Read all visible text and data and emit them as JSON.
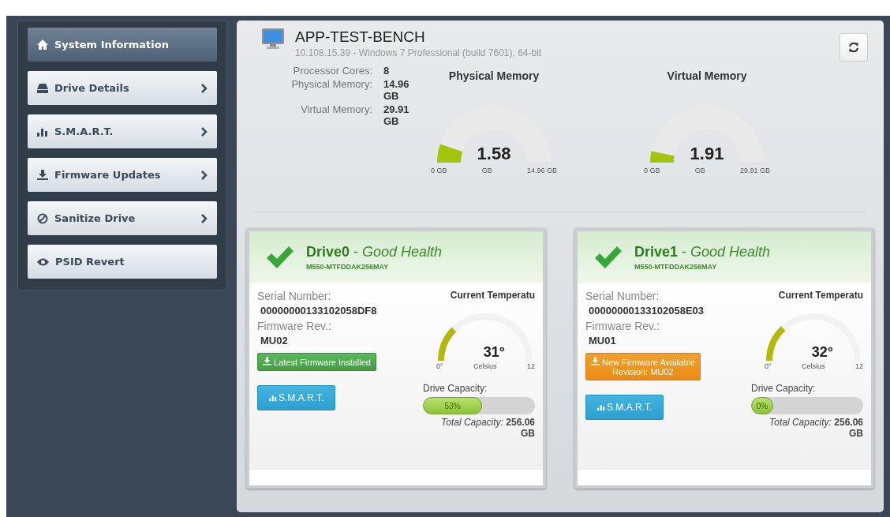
{
  "sidebar": {
    "items": [
      {
        "label": "System Information",
        "selected": true,
        "chevron": false
      },
      {
        "label": "Drive Details",
        "selected": false,
        "chevron": true
      },
      {
        "label": "S.M.A.R.T.",
        "selected": false,
        "chevron": true
      },
      {
        "label": "Firmware Updates",
        "selected": false,
        "chevron": true
      },
      {
        "label": "Sanitize Drive",
        "selected": false,
        "chevron": true
      },
      {
        "label": "PSID Revert",
        "selected": false,
        "chevron": false
      }
    ]
  },
  "system": {
    "hostname": "APP-TEST-BENCH",
    "subtitle": "10.108.15.39 - Windows 7 Professional (build 7601), 64-bit",
    "specs": [
      {
        "label": "Processor Cores:",
        "value": "8"
      },
      {
        "label": "Physical Memory:",
        "value": "14.96 GB"
      },
      {
        "label": "Virtual Memory:",
        "value": "29.91 GB"
      }
    ],
    "gauges": [
      {
        "title": "Physical Memory",
        "value": "1.58",
        "unit": "GB",
        "min": "0 GB",
        "max": "14.96 GB"
      },
      {
        "title": "Virtual Memory",
        "value": "1.91",
        "unit": "GB",
        "min": "0 GB",
        "max": "29.91 GB"
      }
    ]
  },
  "drives": [
    {
      "title": "**Drive0** - *Good Health*",
      "model": "M550-MTFDDAK256MAY",
      "serial_label": "Serial Number:",
      "serial": "00000000133102058DF8",
      "firmware_label": "Firmware Rev.:",
      "firmware": "MU02",
      "firmware_badge": {
        "kind": "latest",
        "text": "Latest Firmware Installed"
      },
      "smart_button": "S.M.A.R.T.",
      "temperature": {
        "title": "Current Temperatu",
        "value": "31°",
        "unit": "Celsius",
        "min": "0°",
        "max": "12"
      },
      "capacity_label": "Drive Capacity:",
      "capacity": {
        "reading": "53%",
        "level": 0.53
      },
      "total": "*Total Capacity:* **256.06 GB**"
    },
    {
      "title": "**Drive1** - *Good Health*",
      "model": "M550-MTFDDAK256MAY",
      "serial_label": "Serial Number:",
      "serial": "00000000133102058E03",
      "firmware_label": "Firmware Rev.:",
      "firmware": "MU01",
      "firmware_badge": {
        "kind": "available",
        "text": "New Firmware Available\nRevision: MU02"
      },
      "smart_button": "S.M.A.R.T.",
      "temperature": {
        "title": "Current Temperatu",
        "value": "32°",
        "unit": "Celsius",
        "min": "0°",
        "max": "12"
      },
      "capacity_label": "Drive Capacity:",
      "capacity": {
        "reading": "0%",
        "level": 0
      },
      "total": "*Total Capacity:* **256.06 GB**"
    }
  ]
}
